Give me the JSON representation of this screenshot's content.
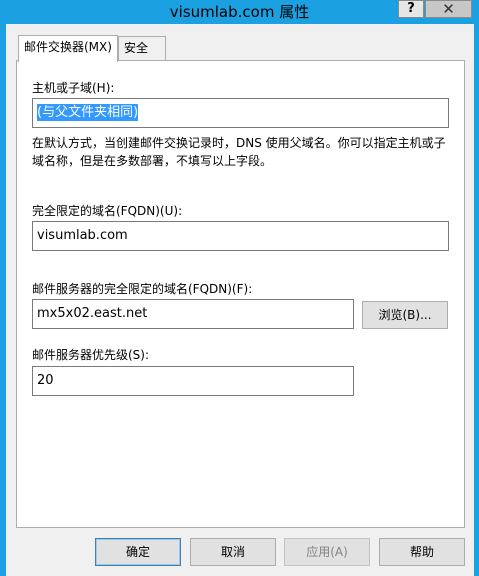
{
  "window": {
    "title": "visumlab.com 属性",
    "help_label": "?",
    "close_label": "✕"
  },
  "tabs": [
    {
      "label": "邮件交换器(MX)",
      "active": true
    },
    {
      "label": "安全",
      "active": false
    }
  ],
  "form": {
    "host_label": "主机或子域(H):",
    "host_value": "(与父文件夹相同)",
    "description": "在默认方式，当创建邮件交换记录时，DNS 使用父域名。你可以指定主机或子域名称，但是在多数部署，不填写以上字段。",
    "fqdn_label": "完全限定的域名(FQDN)(U):",
    "fqdn_value": "visumlab.com",
    "mail_server_label": "邮件服务器的完全限定的域名(FQDN)(F):",
    "mail_server_value": "mx5x02.east.net",
    "browse_label": "浏览(B)...",
    "priority_label": "邮件服务器优先级(S):",
    "priority_value": "20"
  },
  "buttons": {
    "ok": "确定",
    "cancel": "取消",
    "apply": "应用(A)",
    "help": "帮助"
  },
  "colors": {
    "titlebar": "#1ba1e2",
    "selection": "#3399ff"
  }
}
